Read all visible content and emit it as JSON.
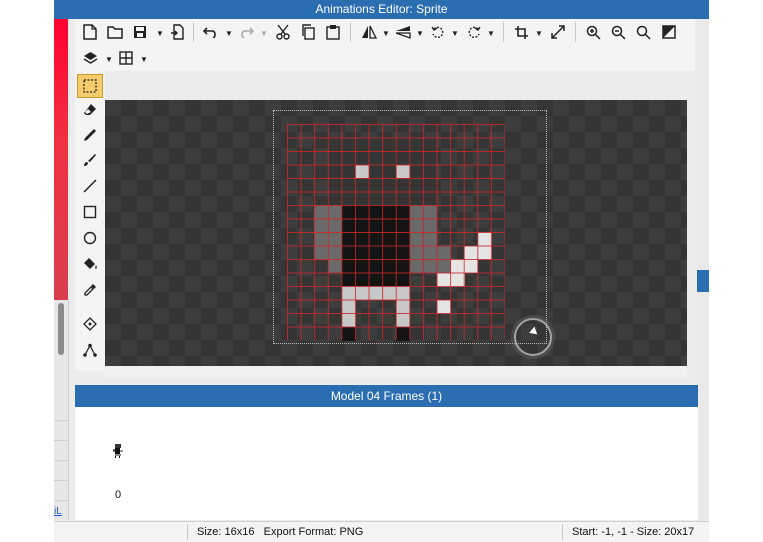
{
  "window": {
    "title": "Animations Editor: Sprite"
  },
  "toolbar": {
    "row1": [
      "new-file-icon",
      "open-folder-icon",
      "save-icon",
      "import-icon",
      "undo-icon",
      "redo-icon",
      "cut-icon",
      "copy-icon",
      "paste-icon",
      "flip-horizontal-icon",
      "flip-vertical-icon",
      "rotate-left-icon",
      "rotate-right-icon",
      "crop-icon",
      "resize-icon",
      "zoom-in-icon",
      "zoom-out-icon",
      "zoom-reset-icon",
      "contrast-icon"
    ],
    "row2": [
      "layers-icon",
      "grid-icon"
    ]
  },
  "tools": [
    "select-rect-icon",
    "eraser-icon",
    "pencil-icon",
    "brush-icon",
    "line-icon",
    "rectangle-icon",
    "ellipse-icon",
    "fill-bucket-icon",
    "eyedropper-icon",
    "anchor-point-icon",
    "skeleton-icon"
  ],
  "colors": {
    "accent": "#2a6db0",
    "grid": "#c82828",
    "selected_tool": "#f7cc6a",
    "canvas_bg": "#3c3c3c"
  },
  "frames": {
    "header": "Model 04 Frames (1)",
    "items": [
      {
        "index": "0"
      }
    ]
  },
  "status": {
    "left": "Size: 16x16   Export Format: PNG",
    "right": "Start: -1, -1 - Size: 20x17"
  },
  "left_panel": {
    "link_text": "iL"
  }
}
